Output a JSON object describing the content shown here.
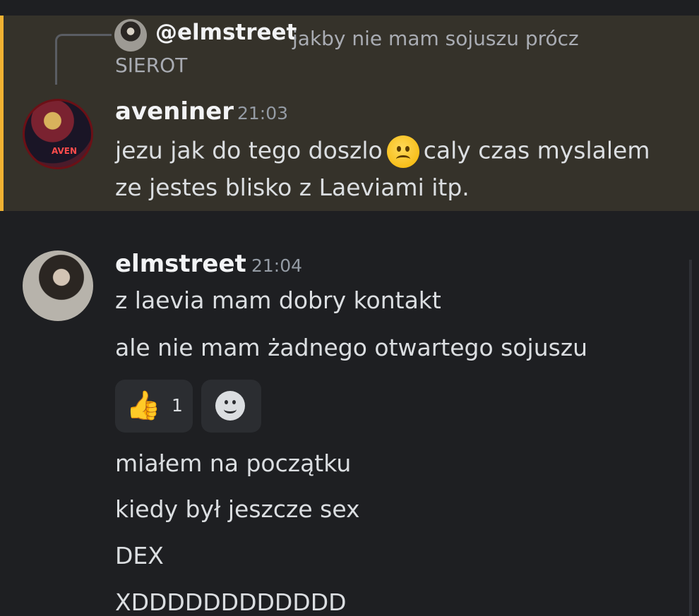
{
  "reply": {
    "author": "@elmstreet",
    "text_line1": "jakby nie mam sojuszu prócz",
    "text_line2": "SIEROT"
  },
  "message1": {
    "author": "aveniner",
    "time": "21:03",
    "line1_a": "jezu jak do tego doszlo",
    "line1_b": "caly czas myslalem",
    "line2": "ze jestes blisko z Laeviami itp.",
    "avatar_label": "AVEN"
  },
  "message2": {
    "author": "elmstreet",
    "time": "21:04",
    "lines": [
      "z laevia mam dobry kontakt",
      "ale nie mam żadnego otwartego sojuszu",
      "miałem na początku",
      "kiedy był jeszcze sex",
      "DEX",
      "XDDDDDDDDDDDD"
    ]
  },
  "reactions": [
    {
      "emoji": "👍",
      "count": "1"
    },
    {
      "emoji": "add-reaction"
    }
  ],
  "colors": {
    "background": "#1e1f22",
    "highlight": "#35322a",
    "highlight_bar": "#f0b232"
  }
}
